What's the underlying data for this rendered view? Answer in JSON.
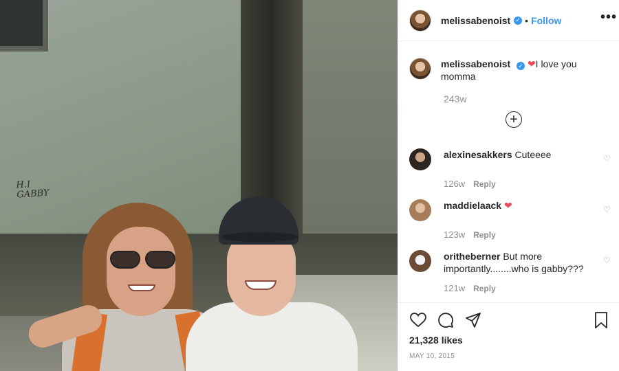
{
  "post": {
    "username": "melissabenoist",
    "verified_mark": "✓",
    "separator": "•",
    "follow_label": "Follow",
    "more_label": "•••"
  },
  "caption": {
    "username": "melissabenoist",
    "heart": "❤",
    "text": "I love you momma",
    "time": "243w",
    "load_more_icon": "+"
  },
  "comments": [
    {
      "username": "alexinesakkers",
      "text": "Cuteeee",
      "time": "126w",
      "reply": "Reply",
      "avatar_color": "#2d2520"
    },
    {
      "username": "maddielaack",
      "text": "❤",
      "time": "123w",
      "reply": "Reply",
      "avatar_color": "#a77d59"
    },
    {
      "username": "oritheberner",
      "text": "But more importantly........who is gabby???",
      "time": "121w",
      "reply": "Reply",
      "avatar_color": "#6b4a36"
    }
  ],
  "actions": {
    "likes": "21,328 likes",
    "date": "MAY 10, 2015"
  },
  "photo": {
    "graffiti": "H.I\nGABBY"
  },
  "colors": {
    "link_blue": "#3897f0",
    "heart_red": "#ed4956",
    "muted_text": "#8e8e8e"
  }
}
